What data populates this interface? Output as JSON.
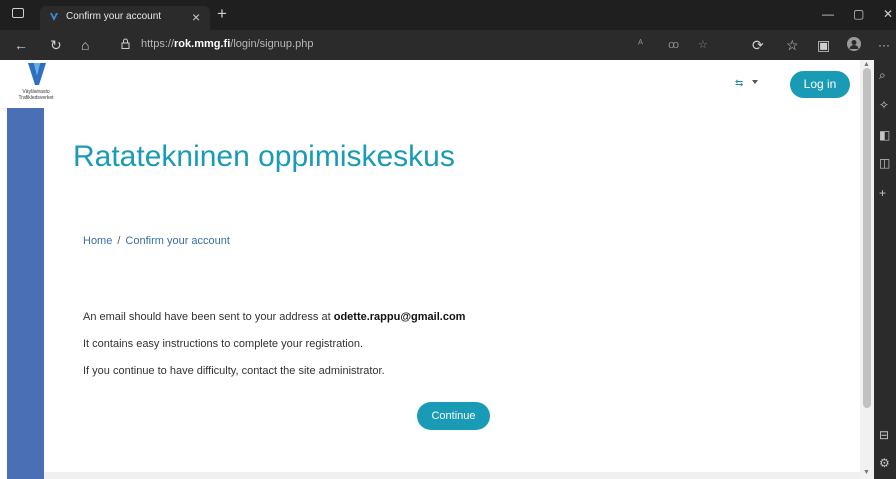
{
  "browser": {
    "tab_title": "Confirm your account",
    "tab_close": "×",
    "new_tab": "+",
    "url_prefix": "https://",
    "url_host": "rok.mmg.fi",
    "url_path": "/login/signup.php",
    "window_controls": {
      "minimize": "—",
      "restore": "▢",
      "close": "✕"
    },
    "icons": [
      "back-icon",
      "refresh-icon",
      "home-icon",
      "lock-icon",
      "read-aloud-icon",
      "immersive-reader-icon",
      "favorites-icon",
      "extensions-icon",
      "collections-icon",
      "profile-icon",
      "more-icon"
    ]
  },
  "site": {
    "logo_line1": "Väylävirasto",
    "logo_line2": "Trafikledsverket",
    "login_label": "Log in",
    "heading": "Ratatekninen oppimiskeskus"
  },
  "breadcrumb": {
    "home": "Home",
    "separator": "/",
    "current": "Confirm your account"
  },
  "message": {
    "line1_prefix": "An email should have been sent to your address at ",
    "email": "odette.rappu@gmail.com",
    "line2": "It contains easy instructions to complete your registration.",
    "line3": "If you continue to have difficulty, contact the site administrator."
  },
  "continue_label": "Continue",
  "colors": {
    "accent": "#1a9bb5",
    "sidebar_blue": "#4a6fb5",
    "chrome_dark": "#2b2b2b"
  }
}
